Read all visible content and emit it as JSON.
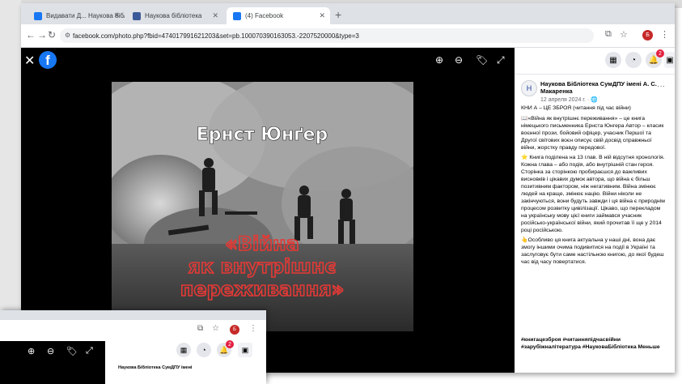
{
  "browser": {
    "tabs": [
      {
        "title": "Видавати Д... Наукова бібліотека",
        "color": "#1877f2"
      },
      {
        "title": "Наукова бібліотека",
        "color": "#3b5998"
      },
      {
        "title": "(4) Facebook",
        "color": "#1877f2"
      }
    ],
    "new_tab": "+",
    "url": "facebook.com/photo.php?fbid=474017991621203&set=pb.100070390163053.-2207520000&type=3",
    "profile_initial": "Б"
  },
  "viewer": {
    "close": "✕",
    "logo": "f",
    "photo": {
      "author": "Ернст Юнґер",
      "title_lines": [
        "«Війна",
        "як внутрішнє",
        "переживання»"
      ]
    }
  },
  "sidebar": {
    "notification_count": "2",
    "page_avatar": "Н",
    "page_name": "Наукова Бібліотека СумДПУ імені А. С. Макаренка",
    "date": "12 апреля 2024 г. · 🌐",
    "more": "···",
    "paragraphs": [
      "КНИ А – ЦЕ ЗБРОЯ (читання під час війни)",
      "📖«Війна як внутрішнє переживання» – це книга німецького письменника Ернста Юнгера Автор – класик воєнної прози, бойовий офіцер, учасник Першої та Другої світових воєн описує свій досвід справжньої війни, жорстку правду передової.",
      "⭐ Книга поділена на 13 глав. В ній відсутня хронологія. Кожна глава – або подія, або внутрішній стан героя. Сторінка за сторінкою пробираєшся до важливих висновків і цікавих думок автора, що війна є більш позитивним фактором, ніж негативним. Війна змінює людей на краще, змінює націю. Війни ніколи не закінчуються, вони будуть завжди і ця війна є природнім процесом розвитку цивілізації. Цікаво, що перекладом на українську мову цієї книги займався учасник російсько-української війни, який прочитав її ще у 2014 році російською.",
      "👆Особливо ця книга актуальна у наші дні, вона дає змогу іншими очима подивитися на події в Україні та заслуговує бути саме настільною книгою, до якої будеш час від часу повертатися."
    ],
    "hashtags": "#книгацезброя #читанняпідчасвійни #зарубіжналітература #НауковаБібліотека Меньше"
  },
  "floating_window": {
    "page_name": "Наукова Бібліотека СумДПУ імені",
    "notification_count": "2"
  }
}
